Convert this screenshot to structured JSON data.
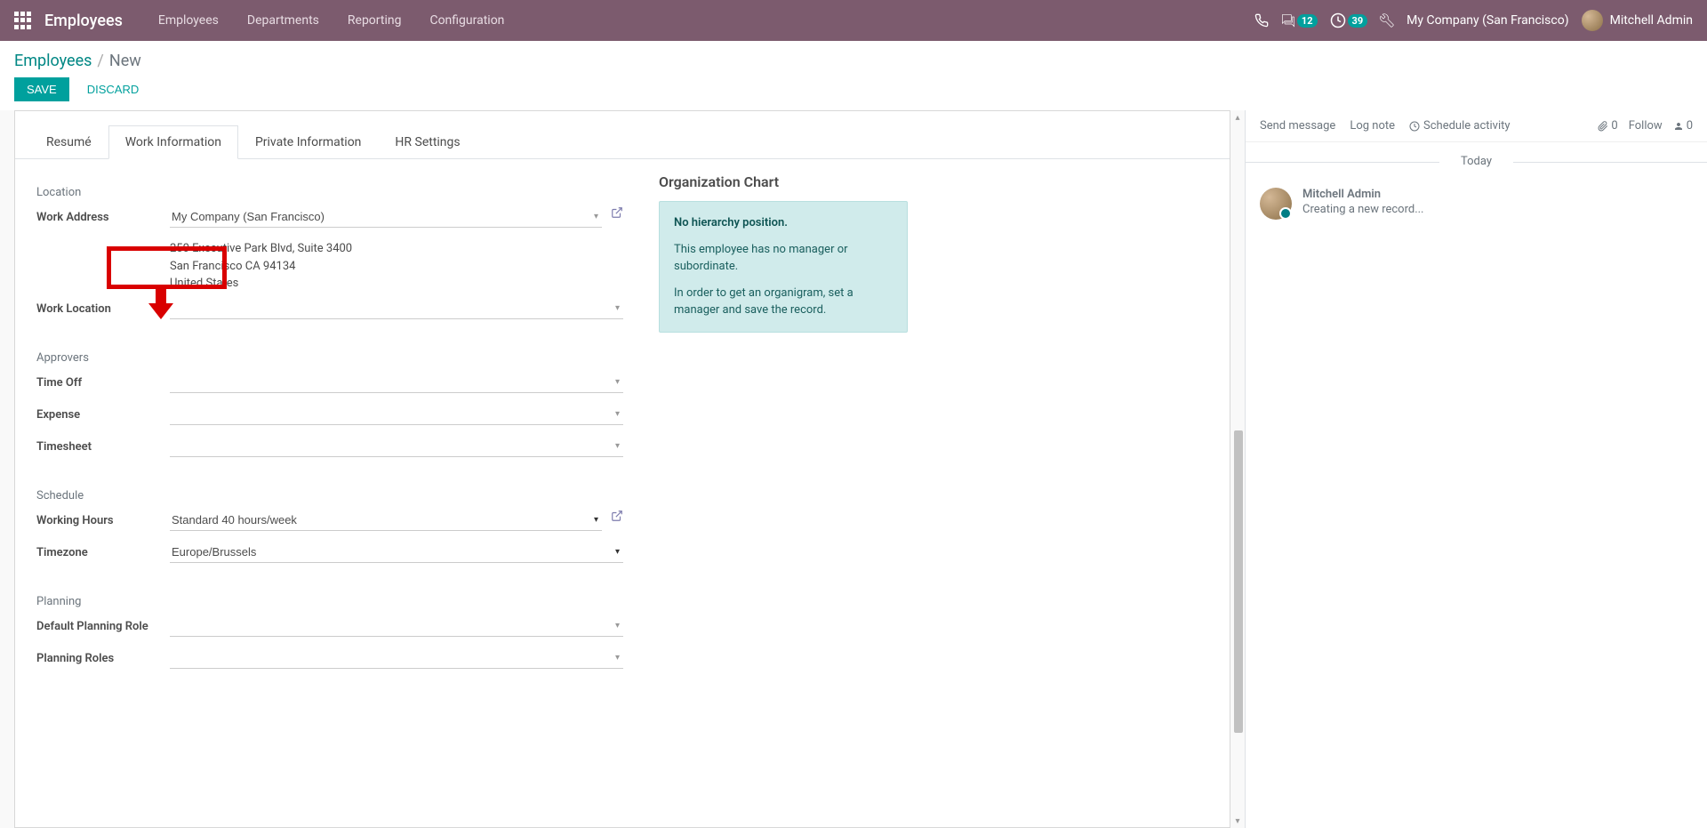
{
  "nav": {
    "brand": "Employees",
    "menu": [
      "Employees",
      "Departments",
      "Reporting",
      "Configuration"
    ],
    "conversations_count": "12",
    "activities_count": "39",
    "company": "My Company (San Francisco)",
    "user_name": "Mitchell Admin"
  },
  "breadcrumb": {
    "parent": "Employees",
    "current": "New"
  },
  "buttons": {
    "save": "Save",
    "discard": "Discard"
  },
  "tabs": [
    "Resumé",
    "Work Information",
    "Private Information",
    "HR Settings"
  ],
  "active_tab_index": 1,
  "sections": {
    "location": {
      "title": "Location",
      "work_address_label": "Work Address",
      "work_address_value": "My Company (San Francisco)",
      "address_line1": "250 Executive Park Blvd, Suite 3400",
      "address_line2": "San Francisco CA 94134",
      "address_line3": "United States",
      "work_location_label": "Work Location",
      "work_location_value": ""
    },
    "approvers": {
      "title": "Approvers",
      "time_off_label": "Time Off",
      "time_off_value": "",
      "expense_label": "Expense",
      "expense_value": "",
      "timesheet_label": "Timesheet",
      "timesheet_value": ""
    },
    "schedule": {
      "title": "Schedule",
      "working_hours_label": "Working Hours",
      "working_hours_value": "Standard 40 hours/week",
      "timezone_label": "Timezone",
      "timezone_value": "Europe/Brussels"
    },
    "planning": {
      "title": "Planning",
      "default_role_label": "Default Planning Role",
      "default_role_value": "",
      "planning_roles_label": "Planning Roles",
      "planning_roles_value": ""
    }
  },
  "org_chart": {
    "title": "Organization Chart",
    "alert_title": "No hierarchy position.",
    "alert_p1": "This employee has no manager or subordinate.",
    "alert_p2": "In order to get an organigram, set a manager and save the record."
  },
  "chatter": {
    "send_message": "Send message",
    "log_note": "Log note",
    "schedule_activity": "Schedule activity",
    "attachments": "0",
    "follow": "Follow",
    "followers": "0",
    "today": "Today",
    "message_author": "Mitchell Admin",
    "message_text": "Creating a new record..."
  }
}
